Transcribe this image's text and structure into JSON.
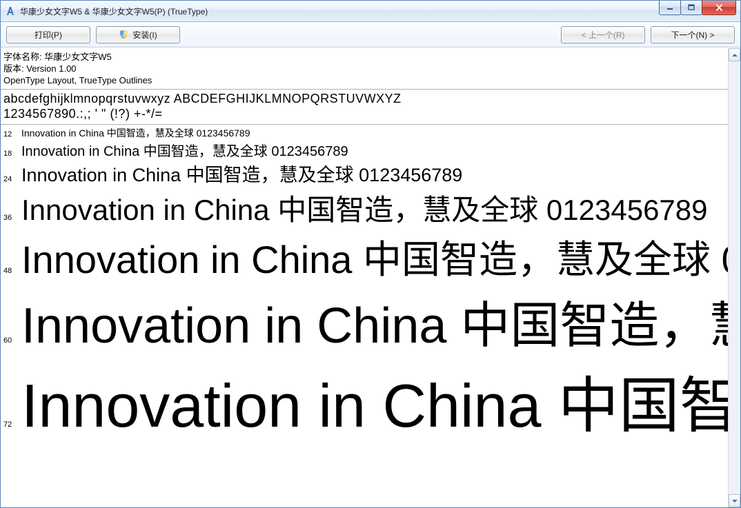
{
  "window": {
    "title": "华康少女文字W5 & 华康少女文字W5(P)  (TrueType)"
  },
  "toolbar": {
    "print_label": "打印(P)",
    "install_label": "安装(I)",
    "prev_label": "< 上一个(R)",
    "next_label": "下一个(N) >"
  },
  "info": {
    "font_name_label": "字体名称:",
    "font_name_value": "华康少女文字W5",
    "version_label": "版本:",
    "version_value": "Version 1.00",
    "tech_line": "OpenType Layout, TrueType Outlines"
  },
  "charset": {
    "line1": "abcdefghijklmnopqrstuvwxyz ABCDEFGHIJKLMNOPQRSTUVWXYZ",
    "line2": "1234567890.:,; ' \" (!?) +-*/="
  },
  "sample_text": "Innovation in China 中国智造，慧及全球 0123456789",
  "samples": [
    {
      "size": "12"
    },
    {
      "size": "18"
    },
    {
      "size": "24"
    },
    {
      "size": "36"
    },
    {
      "size": "48"
    },
    {
      "size": "60"
    },
    {
      "size": "72"
    }
  ]
}
